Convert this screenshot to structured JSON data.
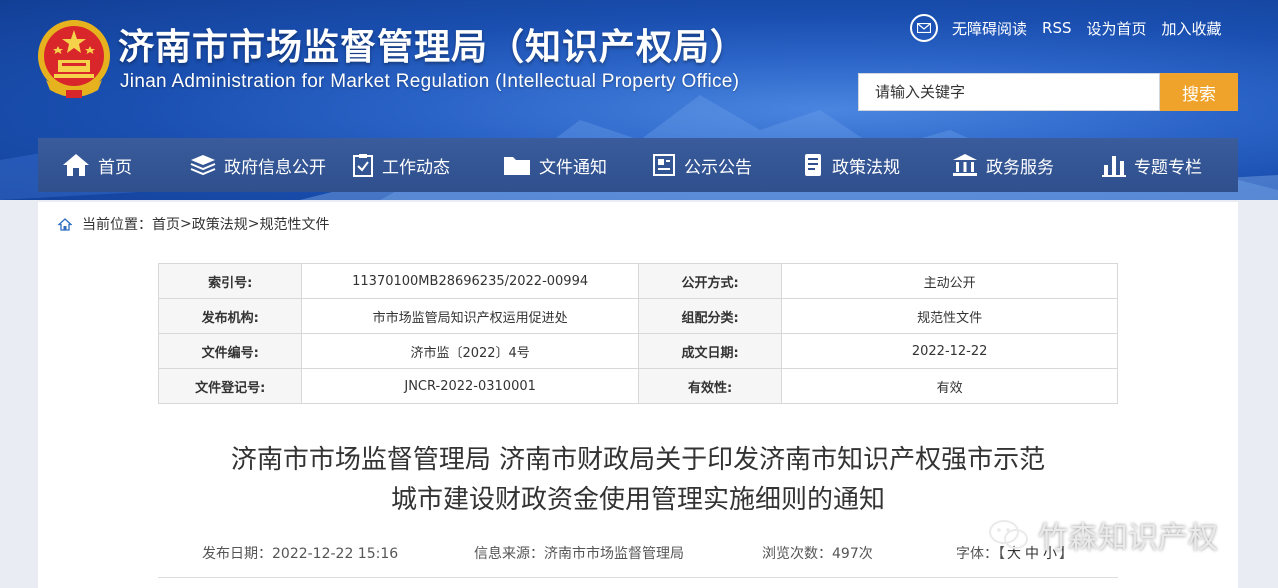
{
  "header": {
    "title_cn": "济南市市场监督管理局（知识产权局）",
    "title_en": "Jinan Administration for Market Regulation (Intellectual Property Office)",
    "emblem_icon": "national-emblem-icon",
    "links": [
      "无障碍阅读",
      "RSS",
      "设为首页",
      "加入收藏"
    ],
    "search": {
      "placeholder": "请输入关键字",
      "button": "搜索"
    },
    "colors": {
      "header_blue": "#1a4fb0",
      "nav": "#2f4f8d",
      "search_button": "#f0a32a"
    }
  },
  "nav": [
    {
      "label": "首页",
      "icon": "home-icon"
    },
    {
      "label": "政府信息公开",
      "icon": "stack-icon"
    },
    {
      "label": "工作动态",
      "icon": "clipboard-icon"
    },
    {
      "label": "文件通知",
      "icon": "folder-icon"
    },
    {
      "label": "公示公告",
      "icon": "notice-icon"
    },
    {
      "label": "政策法规",
      "icon": "book-icon"
    },
    {
      "label": "政务服务",
      "icon": "building-icon"
    },
    {
      "label": "专题专栏",
      "icon": "bar-chart-icon"
    }
  ],
  "breadcrumb": {
    "prefix": "当前位置：",
    "items": [
      "首页",
      "政策法规",
      "规范性文件"
    ],
    "separator": ">"
  },
  "info_table": [
    [
      "索引号:",
      "11370100MB28696235/2022-00994",
      "公开方式:",
      "主动公开"
    ],
    [
      "发布机构:",
      "市市场监管局知识产权运用促进处",
      "组配分类:",
      "规范性文件"
    ],
    [
      "文件编号:",
      "济市监〔2022〕4号",
      "成文日期:",
      "2022-12-22"
    ],
    [
      "文件登记号:",
      "JNCR-2022-0310001",
      "有效性:",
      "有效"
    ]
  ],
  "doc": {
    "title_line1": "济南市市场监督管理局 济南市财政局关于印发济南市知识产权强市示范",
    "title_line2": "城市建设财政资金使用管理实施细则的通知",
    "publish_date": "发布日期：2022-12-22 15:16",
    "source": "信息来源：济南市市场监督管理局",
    "views": "浏览次数：497次",
    "font_label": "字体：",
    "font_open": "【",
    "font_sizes": [
      "大",
      "中",
      "小"
    ],
    "font_close": "】"
  },
  "watermark": {
    "text": "竹森知识产权",
    "icon": "wechat-icon"
  }
}
